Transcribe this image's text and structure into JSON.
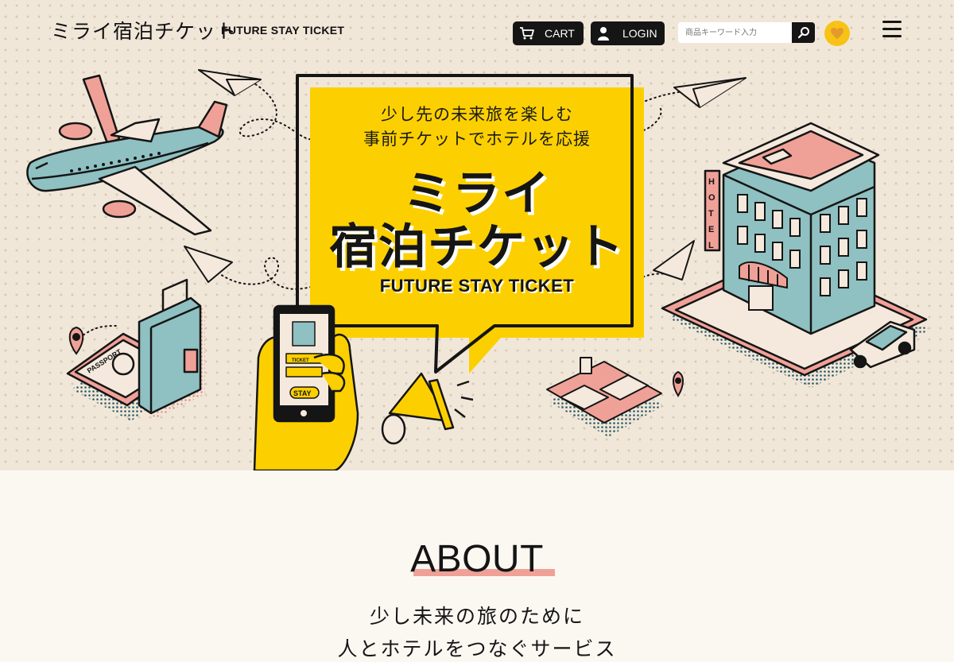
{
  "header": {
    "logo_jp": "ミライ宿泊チケット",
    "logo_en": "FUTURE STAY TICKET",
    "cart_label": "CART",
    "login_label": "LOGIN",
    "search_placeholder": "商品キーワード入力",
    "icons": [
      "cart-icon",
      "user-icon",
      "search-icon",
      "heart-icon",
      "hamburger-menu-icon"
    ]
  },
  "hero": {
    "tagline_1": "少し先の未来旅を楽しむ",
    "tagline_2": "事前チケットでホテルを応援",
    "title_line1": "ミライ",
    "title_line2": "宿泊チケット",
    "title_en": "FUTURE STAY TICKET",
    "illustration_labels": {
      "hotel_sign": "HOTEL",
      "passport": "PASSPORT",
      "phone_button": "STAY",
      "ticket": "TICKET"
    }
  },
  "about": {
    "title": "ABOUT",
    "line1": "少し未来の旅のために",
    "line2": "人とホテルをつなぐサービス"
  },
  "colors": {
    "accent_yellow": "#fcd000",
    "hero_bg": "#f1e7d9",
    "teal": "#8fc0c2",
    "pink": "#f0a197",
    "dark": "#151515"
  }
}
